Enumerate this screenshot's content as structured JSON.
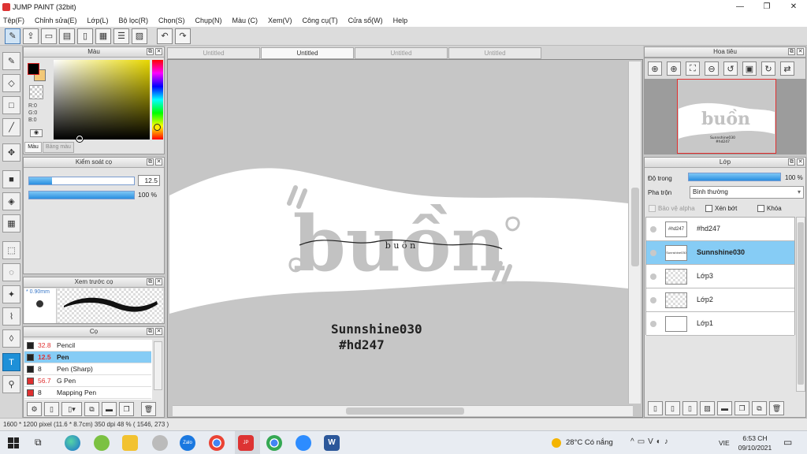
{
  "window": {
    "title": "JUMP PAINT (32bit)",
    "controls": [
      "—",
      "❐",
      "✕"
    ]
  },
  "menu": [
    "Tệp(F)",
    "Chỉnh sửa(E)",
    "Lớp(L)",
    "Bộ lọc(R)",
    "Chọn(S)",
    "Chụp(N)",
    "Màu (C)",
    "Xem(V)",
    "Công cụ(T)",
    "Cửa sổ(W)",
    "Help"
  ],
  "color_panel": {
    "title": "Màu",
    "rgb": [
      "R:0",
      "G:0",
      "B:0"
    ],
    "tabs": [
      "Màu",
      "Bảng màu"
    ]
  },
  "brush_control": {
    "title": "Kiểm soát cọ",
    "size_value": "12.5",
    "opacity_label": "100 %",
    "opacity": 1.0,
    "size": 0.22
  },
  "brush_preview": {
    "title": "Xem trước cọ",
    "size_label": "* 0.90mm"
  },
  "brush_list": {
    "title": "Cọ",
    "items": [
      {
        "size": "32.8",
        "name": "Pencil",
        "color": "#222222",
        "size_color": "#e03030"
      },
      {
        "size": "12.5",
        "name": "Pen",
        "color": "#222222",
        "size_color": "#e03030",
        "selected": true
      },
      {
        "size": "8",
        "name": "Pen (Sharp)",
        "color": "#222222",
        "size_color": "#222222"
      },
      {
        "size": "56.7",
        "name": "G Pen",
        "color": "#e03030",
        "size_color": "#e03030"
      },
      {
        "size": "8",
        "name": "Mapping Pen",
        "color": "#e03030",
        "size_color": "#222222"
      }
    ]
  },
  "doc_tabs": [
    "Untitled",
    "Untitled",
    "Untitled",
    "Untitled"
  ],
  "canvas_art": {
    "big_word": "buồn",
    "small_word": "b u ồ n",
    "line1": "Sunnshine030",
    "line2": "#hd247"
  },
  "navigator": {
    "title": "Hoa tiêu",
    "thumb_text_big": "buồn",
    "thumb_text_small": "Sunnshine030\n#hd247"
  },
  "layers": {
    "title": "Lớp",
    "opacity_label": "Độ trong",
    "opacity_value": "100 %",
    "blend_label": "Pha trộn",
    "blend_value": "Bình thường",
    "checks": [
      "Bảo vệ alpha",
      "Xén bớt",
      "Khóa"
    ],
    "items": [
      {
        "name": "#hd247",
        "thumb": "#hd247"
      },
      {
        "name": "Sunnshine030",
        "thumb": "Sunnshine030",
        "selected": true
      },
      {
        "name": "Lớp3",
        "thumb": ""
      },
      {
        "name": "Lớp2",
        "thumb": ""
      },
      {
        "name": "Lớp1",
        "thumb": ""
      }
    ]
  },
  "status": "1600 * 1200 pixel   (11.6 * 8.7cm)   350 dpi   48 %   ( 1546, 273 )",
  "taskbar": {
    "weather": "28°C  Có nắng",
    "lang": "VIE",
    "time": "6:53 CH",
    "date": "09/10/2021"
  }
}
